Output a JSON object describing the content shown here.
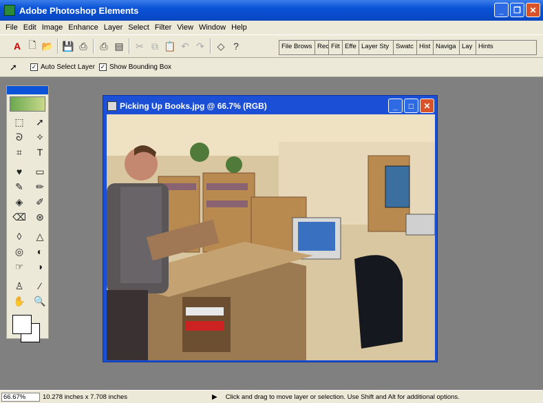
{
  "app": {
    "title": "Adobe Photoshop Elements"
  },
  "menu": [
    "File",
    "Edit",
    "Image",
    "Enhance",
    "Layer",
    "Select",
    "Filter",
    "View",
    "Window",
    "Help"
  ],
  "palette_tabs": [
    "File Brows",
    "Rec",
    "Filt",
    "Effe",
    "Layer Sty",
    "Swatc",
    "Hist",
    "Naviga",
    "Lay",
    "Hints"
  ],
  "options": {
    "auto_select": "Auto Select Layer",
    "bounding_box": "Show Bounding Box"
  },
  "document": {
    "title": "Picking Up Books.jpg @ 66.7% (RGB)"
  },
  "status": {
    "zoom": "66.67%",
    "doc_info": "10.278 inches x 7.708 inches",
    "hint": "Click and drag to move layer or selection.  Use Shift and Alt for additional options."
  },
  "icons": {
    "window_minimize": "minimize-icon",
    "window_restore": "restore-icon",
    "window_close": "close-icon"
  }
}
